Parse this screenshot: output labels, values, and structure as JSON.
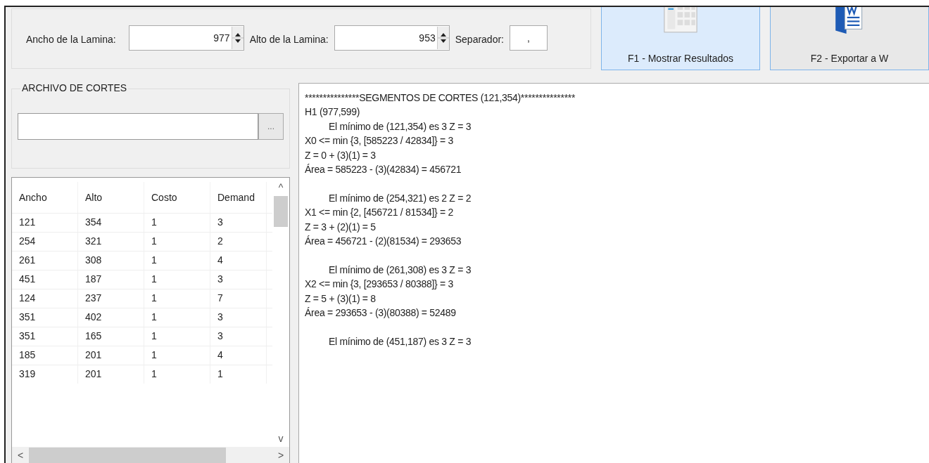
{
  "dimensions": {
    "ancho": {
      "label": "Ancho de la Lamina:",
      "value": "977"
    },
    "alto": {
      "label": "Alto de la Lamina:",
      "value": "953"
    },
    "separador": {
      "label": "Separador:",
      "value": ","
    }
  },
  "buttons": [
    {
      "kind": "table",
      "label": "F1 - Mostrar Resultados",
      "selected": true
    },
    {
      "kind": "word",
      "label": "F2 - Exportar a W",
      "selected": false
    }
  ],
  "archivo": {
    "title": "ARCHIVO DE CORTES",
    "browse": "..."
  },
  "table": {
    "columns": [
      "Ancho",
      "Alto",
      "Costo",
      "Demand"
    ],
    "rows": [
      [
        "121",
        "354",
        "1",
        "3"
      ],
      [
        "254",
        "321",
        "1",
        "2"
      ],
      [
        "261",
        "308",
        "1",
        "4"
      ],
      [
        "451",
        "187",
        "1",
        "3"
      ],
      [
        "124",
        "237",
        "1",
        "7"
      ],
      [
        "351",
        "402",
        "1",
        "3"
      ],
      [
        "351",
        "165",
        "1",
        "3"
      ],
      [
        "185",
        "201",
        "1",
        "4"
      ],
      [
        "319",
        "201",
        "1",
        "1"
      ]
    ],
    "scroll_up": "^",
    "scroll_down": "v",
    "scroll_left": "<",
    "scroll_right": ">"
  },
  "output": [
    {
      "text": "***************SEGMENTOS DE CORTES (121,354)***************",
      "indent": false,
      "gap_before": false
    },
    {
      "text": "H1 (977,599)",
      "indent": false,
      "gap_before": false
    },
    {
      "text": "El mínimo de (121,354) es 3 Z = 3",
      "indent": true,
      "gap_before": false
    },
    {
      "text": "X0 <= min {3, [585223 / 42834]} = 3",
      "indent": false,
      "gap_before": false
    },
    {
      "text": "Z = 0 + (3)(1) = 3",
      "indent": false,
      "gap_before": false
    },
    {
      "text": "Área = 585223 - (3)(42834) = 456721",
      "indent": false,
      "gap_before": false
    },
    {
      "text": "El mínimo de (254,321) es 2 Z = 2",
      "indent": true,
      "gap_before": true
    },
    {
      "text": "X1 <= min {2, [456721 / 81534]} = 2",
      "indent": false,
      "gap_before": false
    },
    {
      "text": "Z = 3 + (2)(1) = 5",
      "indent": false,
      "gap_before": false
    },
    {
      "text": "Área = 456721 - (2)(81534) = 293653",
      "indent": false,
      "gap_before": false
    },
    {
      "text": "El mínimo de (261,308) es 3 Z = 3",
      "indent": true,
      "gap_before": true
    },
    {
      "text": "X2 <= min {3, [293653 / 80388]} = 3",
      "indent": false,
      "gap_before": false
    },
    {
      "text": "Z = 5 + (3)(1) = 8",
      "indent": false,
      "gap_before": false
    },
    {
      "text": "Área = 293653 - (3)(80388) = 52489",
      "indent": false,
      "gap_before": false
    },
    {
      "text": "El mínimo de (451,187) es 3 Z = 3",
      "indent": true,
      "gap_before": true
    }
  ]
}
